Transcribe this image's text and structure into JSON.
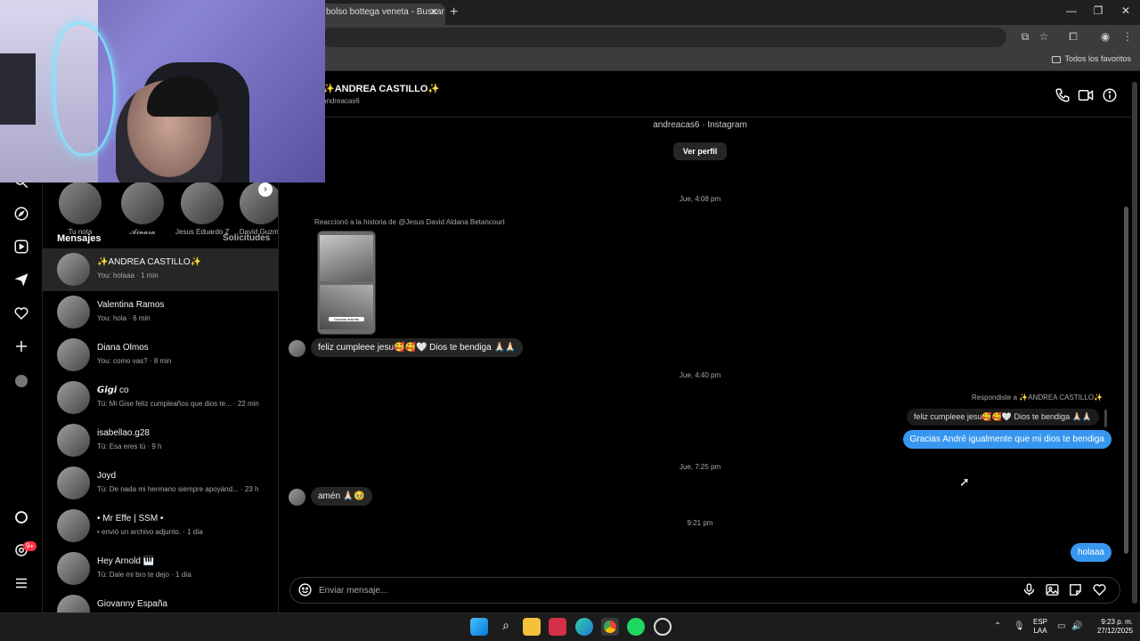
{
  "browser": {
    "tab_title": "bolso bottega veneta - Buscar",
    "tab_close": "✕",
    "new_tab": "+",
    "bookmarks_label": "Todos los favoritos",
    "win_minimize": "—",
    "win_restore": "❐",
    "win_close": "✕"
  },
  "stories": [
    {
      "name": "Tu nota"
    },
    {
      "name": "𝓐𝓲𝓷𝓪𝓻𝓪"
    },
    {
      "name": "Jesus Eduardo Z..."
    },
    {
      "name": "David Guzma"
    }
  ],
  "sidebar": {
    "title": "Mensajes",
    "requests": "Solicitudes",
    "notification_badge": "9+"
  },
  "conversations": [
    {
      "name": "✨ANDREA CASTILLO✨",
      "preview": "You: holaaa · 1 min"
    },
    {
      "name": "Valentina Ramos",
      "preview": "You: hola · 6 min"
    },
    {
      "name": "Diana Olmos",
      "preview": "You: como vas? · 8 min"
    },
    {
      "name": "𝙂𝙞𝙜𝙞 co",
      "preview": "Tú: Mi Gise feliz cumpleaños que dios te... · 22 min"
    },
    {
      "name": "isabellao.g28",
      "preview": "Tú: Esa eres tú · 9 h"
    },
    {
      "name": "Joyd",
      "preview": "Tú: De nada mi hermano siempre apoyánd... · 23 h"
    },
    {
      "name": "• Mr Effe | SSM •",
      "preview": "• envió un archivo adjunto. · 1 día"
    },
    {
      "name": "Hey Arnold 🎹",
      "preview": "Tú: Dale mi bro te dejo · 1 día"
    },
    {
      "name": "Giovanny España",
      "preview": ""
    }
  ],
  "chat": {
    "name": "✨ANDREA CASTILLO✨",
    "username": "andreacas6",
    "profile_source": "andreacas6 · Instagram",
    "view_profile": "Ver perfil",
    "time1": "Jue, 4:08 pm",
    "reacted_story": "Reaccionó a la historia de @Jesus David Aldana Betancourt",
    "story_caption": "Gracias mamita",
    "msg_in_1": "feliz cumpleee jesu🥰🥰🤍 Dios te bendiga 🙏🏻🙏🏻",
    "time2": "Jue, 4:40 pm",
    "replied_label": "Respondiste a ✨ANDREA CASTILLO✨",
    "replied_quote": "feliz cumpleee jesu🥰🥰🤍 Dios te bendiga 🙏🏻🙏🏻",
    "msg_out_1": "Gracias André igualmente que mi dios te bendiga",
    "time3": "Jue, 7:25 pm",
    "msg_in_2": "amén 🙏🏻🥹",
    "time4": "9:21 pm",
    "msg_out_2": "holaaa"
  },
  "composer": {
    "placeholder": "Enviar mensaje..."
  },
  "taskbar": {
    "lang_top": "ESP",
    "lang_bottom": "LAA",
    "time": "9:23 p. m.",
    "date": "27/12/2025"
  },
  "colors": {
    "accent_blue": "#3797f0",
    "bubble_in": "#262626",
    "background": "#000000"
  }
}
